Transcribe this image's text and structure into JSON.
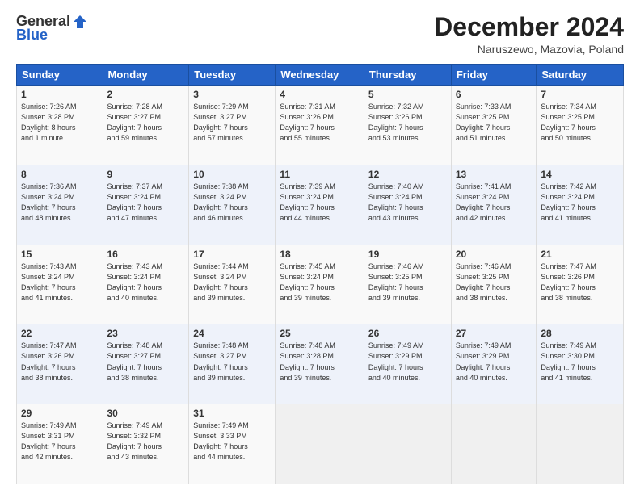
{
  "header": {
    "logo_general": "General",
    "logo_blue": "Blue",
    "month_title": "December 2024",
    "location": "Naruszewo, Mazovia, Poland"
  },
  "days_of_week": [
    "Sunday",
    "Monday",
    "Tuesday",
    "Wednesday",
    "Thursday",
    "Friday",
    "Saturday"
  ],
  "weeks": [
    [
      {
        "day": "1",
        "info": "Sunrise: 7:26 AM\nSunset: 3:28 PM\nDaylight: 8 hours\nand 1 minute."
      },
      {
        "day": "2",
        "info": "Sunrise: 7:28 AM\nSunset: 3:27 PM\nDaylight: 7 hours\nand 59 minutes."
      },
      {
        "day": "3",
        "info": "Sunrise: 7:29 AM\nSunset: 3:27 PM\nDaylight: 7 hours\nand 57 minutes."
      },
      {
        "day": "4",
        "info": "Sunrise: 7:31 AM\nSunset: 3:26 PM\nDaylight: 7 hours\nand 55 minutes."
      },
      {
        "day": "5",
        "info": "Sunrise: 7:32 AM\nSunset: 3:26 PM\nDaylight: 7 hours\nand 53 minutes."
      },
      {
        "day": "6",
        "info": "Sunrise: 7:33 AM\nSunset: 3:25 PM\nDaylight: 7 hours\nand 51 minutes."
      },
      {
        "day": "7",
        "info": "Sunrise: 7:34 AM\nSunset: 3:25 PM\nDaylight: 7 hours\nand 50 minutes."
      }
    ],
    [
      {
        "day": "8",
        "info": "Sunrise: 7:36 AM\nSunset: 3:24 PM\nDaylight: 7 hours\nand 48 minutes."
      },
      {
        "day": "9",
        "info": "Sunrise: 7:37 AM\nSunset: 3:24 PM\nDaylight: 7 hours\nand 47 minutes."
      },
      {
        "day": "10",
        "info": "Sunrise: 7:38 AM\nSunset: 3:24 PM\nDaylight: 7 hours\nand 46 minutes."
      },
      {
        "day": "11",
        "info": "Sunrise: 7:39 AM\nSunset: 3:24 PM\nDaylight: 7 hours\nand 44 minutes."
      },
      {
        "day": "12",
        "info": "Sunrise: 7:40 AM\nSunset: 3:24 PM\nDaylight: 7 hours\nand 43 minutes."
      },
      {
        "day": "13",
        "info": "Sunrise: 7:41 AM\nSunset: 3:24 PM\nDaylight: 7 hours\nand 42 minutes."
      },
      {
        "day": "14",
        "info": "Sunrise: 7:42 AM\nSunset: 3:24 PM\nDaylight: 7 hours\nand 41 minutes."
      }
    ],
    [
      {
        "day": "15",
        "info": "Sunrise: 7:43 AM\nSunset: 3:24 PM\nDaylight: 7 hours\nand 41 minutes."
      },
      {
        "day": "16",
        "info": "Sunrise: 7:43 AM\nSunset: 3:24 PM\nDaylight: 7 hours\nand 40 minutes."
      },
      {
        "day": "17",
        "info": "Sunrise: 7:44 AM\nSunset: 3:24 PM\nDaylight: 7 hours\nand 39 minutes."
      },
      {
        "day": "18",
        "info": "Sunrise: 7:45 AM\nSunset: 3:24 PM\nDaylight: 7 hours\nand 39 minutes."
      },
      {
        "day": "19",
        "info": "Sunrise: 7:46 AM\nSunset: 3:25 PM\nDaylight: 7 hours\nand 39 minutes."
      },
      {
        "day": "20",
        "info": "Sunrise: 7:46 AM\nSunset: 3:25 PM\nDaylight: 7 hours\nand 38 minutes."
      },
      {
        "day": "21",
        "info": "Sunrise: 7:47 AM\nSunset: 3:26 PM\nDaylight: 7 hours\nand 38 minutes."
      }
    ],
    [
      {
        "day": "22",
        "info": "Sunrise: 7:47 AM\nSunset: 3:26 PM\nDaylight: 7 hours\nand 38 minutes."
      },
      {
        "day": "23",
        "info": "Sunrise: 7:48 AM\nSunset: 3:27 PM\nDaylight: 7 hours\nand 38 minutes."
      },
      {
        "day": "24",
        "info": "Sunrise: 7:48 AM\nSunset: 3:27 PM\nDaylight: 7 hours\nand 39 minutes."
      },
      {
        "day": "25",
        "info": "Sunrise: 7:48 AM\nSunset: 3:28 PM\nDaylight: 7 hours\nand 39 minutes."
      },
      {
        "day": "26",
        "info": "Sunrise: 7:49 AM\nSunset: 3:29 PM\nDaylight: 7 hours\nand 40 minutes."
      },
      {
        "day": "27",
        "info": "Sunrise: 7:49 AM\nSunset: 3:29 PM\nDaylight: 7 hours\nand 40 minutes."
      },
      {
        "day": "28",
        "info": "Sunrise: 7:49 AM\nSunset: 3:30 PM\nDaylight: 7 hours\nand 41 minutes."
      }
    ],
    [
      {
        "day": "29",
        "info": "Sunrise: 7:49 AM\nSunset: 3:31 PM\nDaylight: 7 hours\nand 42 minutes."
      },
      {
        "day": "30",
        "info": "Sunrise: 7:49 AM\nSunset: 3:32 PM\nDaylight: 7 hours\nand 43 minutes."
      },
      {
        "day": "31",
        "info": "Sunrise: 7:49 AM\nSunset: 3:33 PM\nDaylight: 7 hours\nand 44 minutes."
      },
      {
        "day": "",
        "info": ""
      },
      {
        "day": "",
        "info": ""
      },
      {
        "day": "",
        "info": ""
      },
      {
        "day": "",
        "info": ""
      }
    ]
  ]
}
